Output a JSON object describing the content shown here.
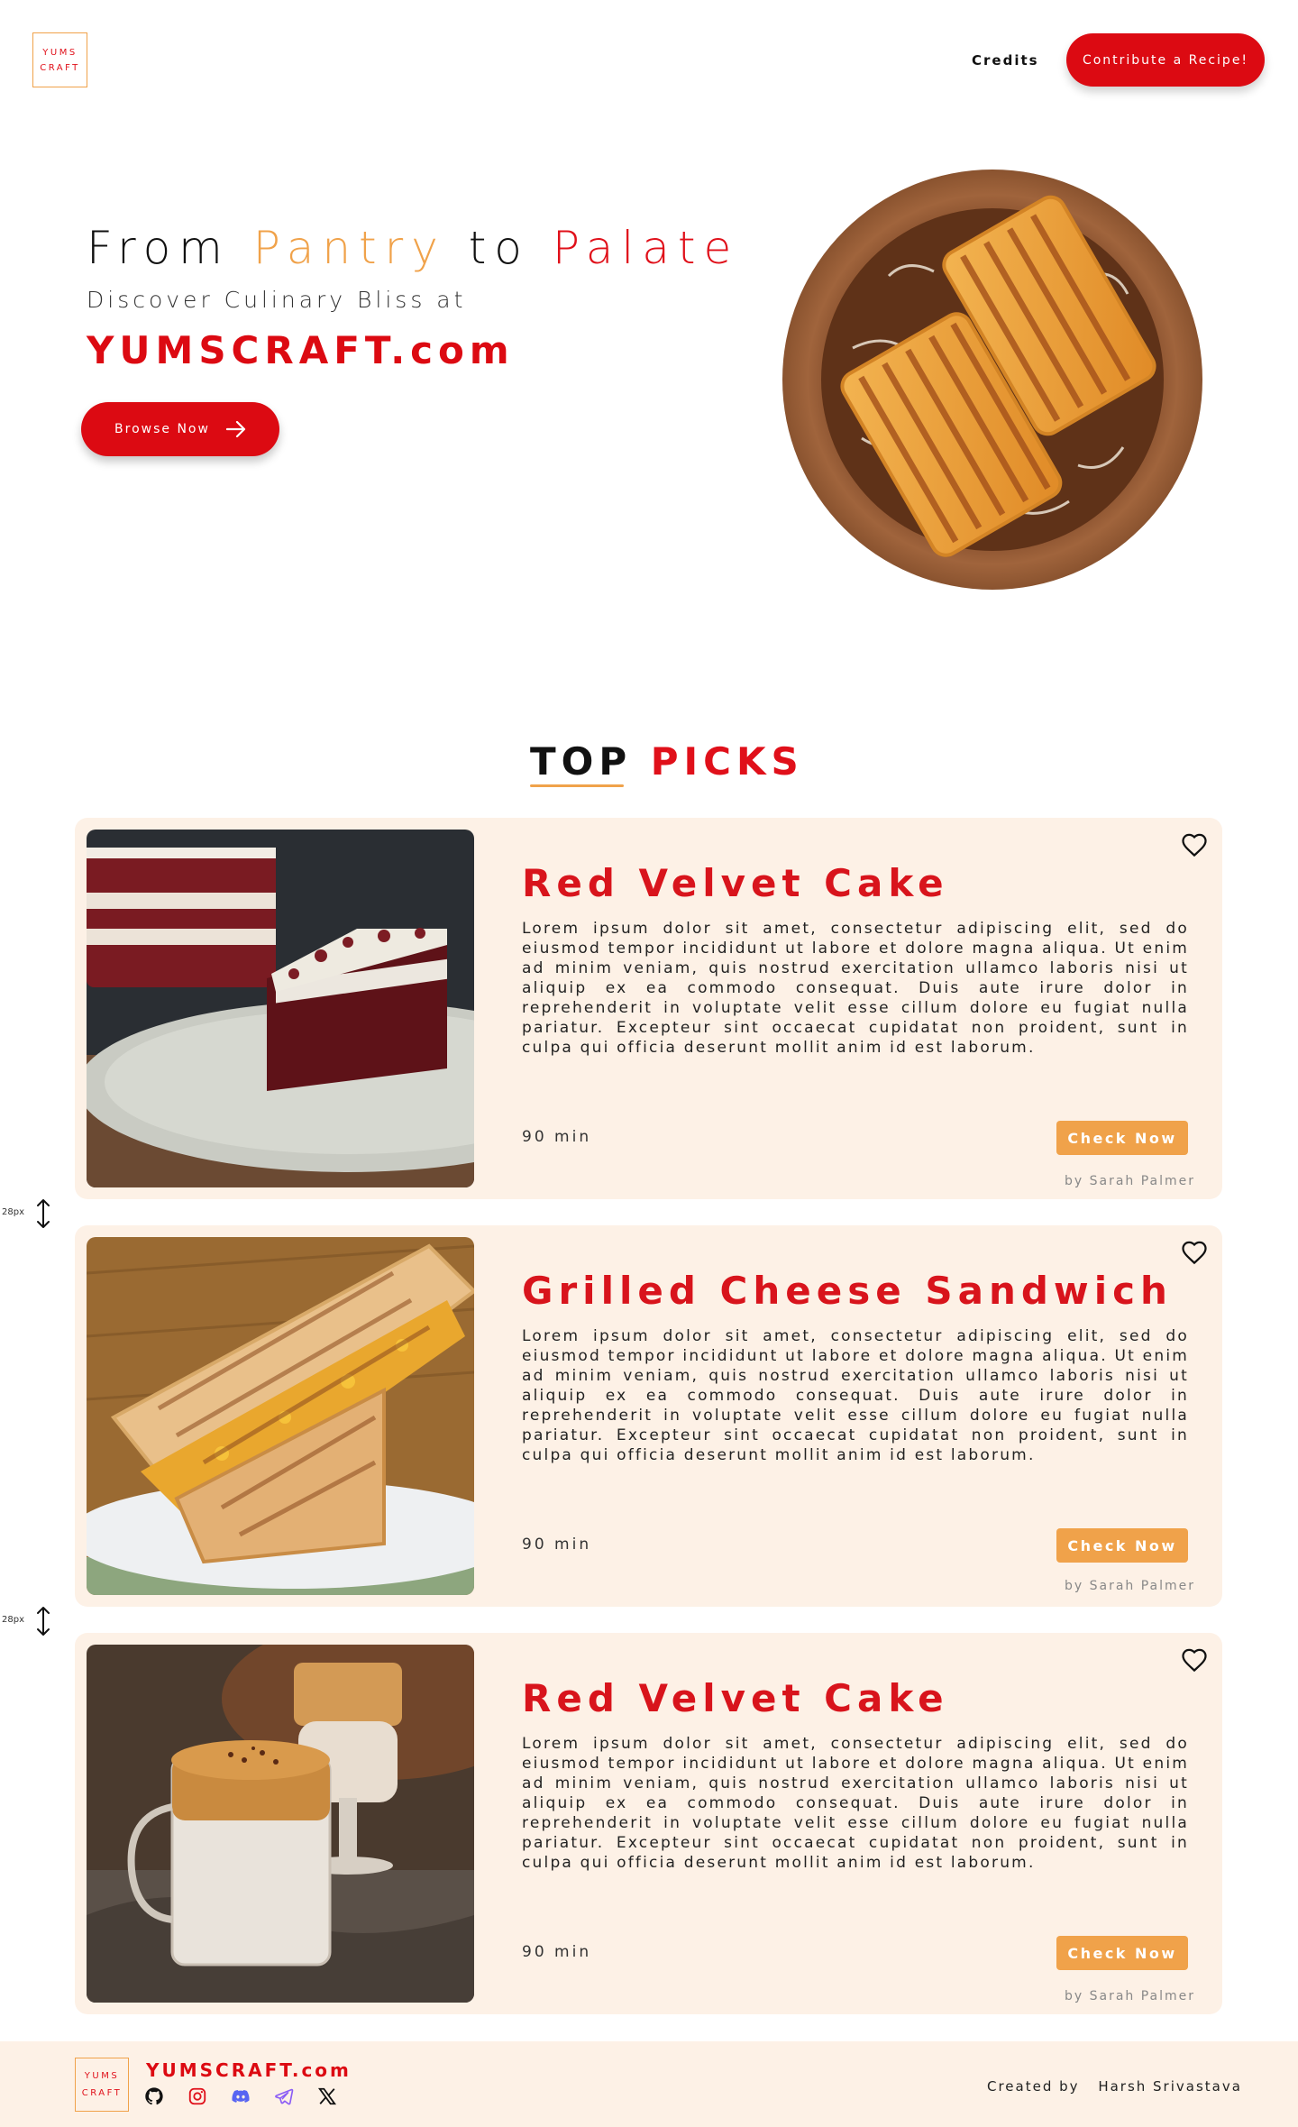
{
  "header": {
    "logo_line1": "YUMS",
    "logo_line2": "CRAFT",
    "nav_credits": "Credits",
    "contribute_label": "Contribute a Recipe!"
  },
  "hero": {
    "title_word1": "From",
    "title_word2": "Pantry",
    "title_word3": "to",
    "title_word4": "Palate",
    "subtitle": "Discover Culinary Bliss at",
    "brand": "YUMSCRAFT.com",
    "browse_label": "Browse Now"
  },
  "top_picks": {
    "title_part1": "TOP",
    "title_part2": "PICKS",
    "gap_label": "28px",
    "cards": [
      {
        "title": "Red Velvet Cake",
        "description": "Lorem ipsum dolor sit amet, consectetur adipiscing elit, sed do eiusmod tempor incididunt ut labore et dolore magna aliqua. Ut enim ad minim veniam, quis nostrud exercitation ullamco laboris nisi ut aliquip ex ea commodo consequat. Duis aute irure dolor in reprehenderit in voluptate velit esse cillum dolore eu fugiat nulla pariatur. Excepteur sint occaecat cupidatat non proident, sunt in culpa qui officia deserunt mollit anim id est laborum.",
        "time": "90 min",
        "button_label": "Check Now",
        "author": "by Sarah Palmer",
        "image": "red-velvet-cake"
      },
      {
        "title": "Grilled Cheese Sandwich",
        "description": "Lorem ipsum dolor sit amet, consectetur adipiscing elit, sed do eiusmod tempor incididunt ut labore et dolore magna aliqua. Ut enim ad minim veniam, quis nostrud exercitation ullamco laboris nisi ut aliquip ex ea commodo consequat. Duis aute irure dolor in reprehenderit in voluptate velit esse cillum dolore eu fugiat nulla pariatur. Excepteur sint occaecat cupidatat non proident, sunt in culpa qui officia deserunt mollit anim id est laborum.",
        "time": "90 min",
        "button_label": "Check Now",
        "author": "by Sarah Palmer",
        "image": "grilled-cheese-sandwich"
      },
      {
        "title": "Red Velvet Cake",
        "description": "Lorem ipsum dolor sit amet, consectetur adipiscing elit, sed do eiusmod tempor incididunt ut labore et dolore magna aliqua. Ut enim ad minim veniam, quis nostrud exercitation ullamco laboris nisi ut aliquip ex ea commodo consequat. Duis aute irure dolor in reprehenderit in voluptate velit esse cillum dolore eu fugiat nulla pariatur. Excepteur sint occaecat cupidatat non proident, sunt in culpa qui officia deserunt mollit anim id est laborum.",
        "time": "90 min",
        "button_label": "Check Now",
        "author": "by Sarah Palmer",
        "image": "dalgona-coffee"
      }
    ]
  },
  "footer": {
    "logo_line1": "YUMS",
    "logo_line2": "CRAFT",
    "brand": "YUMSCRAFT.com",
    "created_by_label": "Created by",
    "author": "Harsh Srivastava",
    "social_icons": [
      "github-icon",
      "instagram-icon",
      "discord-icon",
      "telegram-icon",
      "x-icon"
    ]
  },
  "colors": {
    "brand_red": "#dc0a12",
    "accent_orange": "#f0a24a",
    "card_bg": "#fdf1e6"
  }
}
